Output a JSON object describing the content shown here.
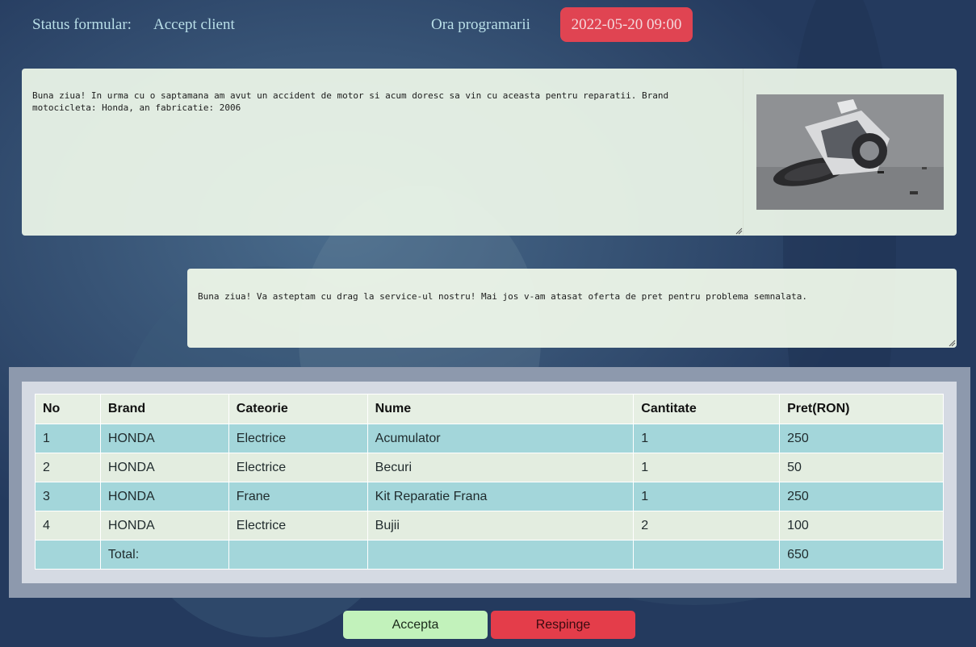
{
  "header": {
    "status_label": "Status formular:",
    "status_value": "Accept client",
    "appointment_label": "Ora programarii",
    "appointment_value": "2022-05-20 09:00"
  },
  "client_message": {
    "text": "Buna ziua! In urma cu o saptamana am avut un accident de motor si acum doresc sa vin cu aceasta pentru reparatii. Brand motocicleta: Honda, an fabricatie: 2006",
    "photo_icon": "crashed-motorcycle-photo"
  },
  "reply_message": {
    "text": "Buna ziua! Va asteptam cu drag la service-ul nostru! Mai jos v-am atasat oferta de pret pentru problema semnalata."
  },
  "offer_table": {
    "columns": [
      "No",
      "Brand",
      "Cateorie",
      "Nume",
      "Cantitate",
      "Pret(RON)"
    ],
    "rows": [
      [
        "1",
        "HONDA",
        "Electrice",
        "Acumulator",
        "1",
        "250"
      ],
      [
        "2",
        "HONDA",
        "Electrice",
        "Becuri",
        "1",
        "50"
      ],
      [
        "3",
        "HONDA",
        "Frane",
        "Kit Reparatie Frana",
        "1",
        "250"
      ],
      [
        "4",
        "HONDA",
        "Electrice",
        "Bujii",
        "2",
        "100"
      ]
    ],
    "total_label": "Total:",
    "total_value": "650"
  },
  "actions": {
    "accept_label": "Accepta",
    "reject_label": "Respinge"
  },
  "colors": {
    "background": "#2a4166",
    "appointment_badge": "#e04452",
    "accept": "#c2f2bb",
    "reject": "#e43d4a",
    "row_teal": "#a3d6da",
    "row_light": "#e3ede0"
  }
}
